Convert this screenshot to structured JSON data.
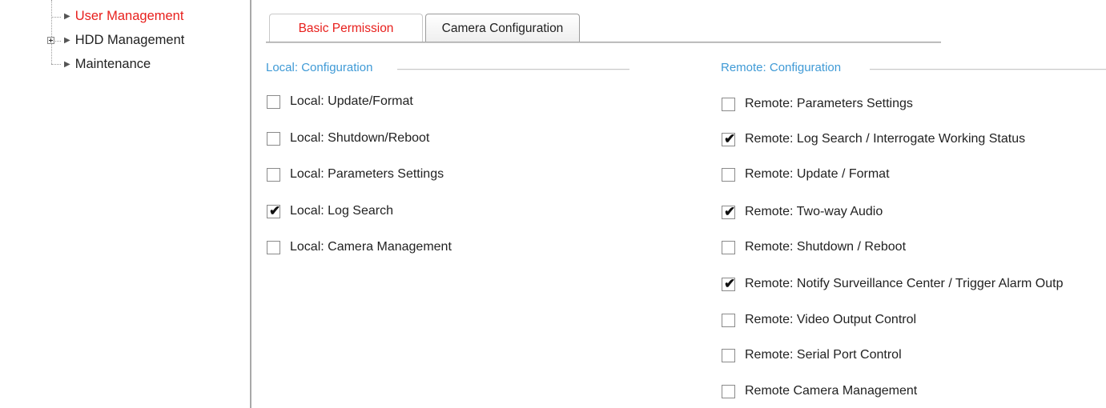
{
  "sidebar": {
    "items": [
      {
        "label": "User Management",
        "active": true,
        "expandable": false
      },
      {
        "label": "HDD Management",
        "active": false,
        "expandable": true
      },
      {
        "label": "Maintenance",
        "active": false,
        "expandable": false
      }
    ]
  },
  "tabs": [
    {
      "label": "Basic Permission",
      "active": true
    },
    {
      "label": "Camera Configuration",
      "active": false
    }
  ],
  "local": {
    "title": "Local: Configuration",
    "permissions": [
      {
        "label": "Local: Update/Format",
        "checked": false
      },
      {
        "label": "Local: Shutdown/Reboot",
        "checked": false
      },
      {
        "label": "Local: Parameters Settings",
        "checked": false
      },
      {
        "label": "Local: Log Search",
        "checked": true
      },
      {
        "label": "Local: Camera Management",
        "checked": false
      }
    ]
  },
  "remote": {
    "title": "Remote: Configuration",
    "permissions": [
      {
        "label": "Remote: Parameters Settings",
        "checked": false
      },
      {
        "label": "Remote: Log Search / Interrogate Working Status",
        "checked": true
      },
      {
        "label": "Remote: Update / Format",
        "checked": false
      },
      {
        "label": "Remote: Two-way Audio",
        "checked": true
      },
      {
        "label": "Remote: Shutdown / Reboot",
        "checked": false
      },
      {
        "label": "Remote: Notify Surveillance Center / Trigger Alarm Outp",
        "checked": true
      },
      {
        "label": "Remote: Video Output Control",
        "checked": false
      },
      {
        "label": "Remote: Serial Port Control",
        "checked": false
      },
      {
        "label": "Remote Camera Management",
        "checked": false
      }
    ]
  },
  "colors": {
    "accent_red": "#e8201d",
    "section_blue": "#3f9ad6"
  },
  "icons": {
    "tree_arrow": "▶",
    "check": "✔"
  }
}
